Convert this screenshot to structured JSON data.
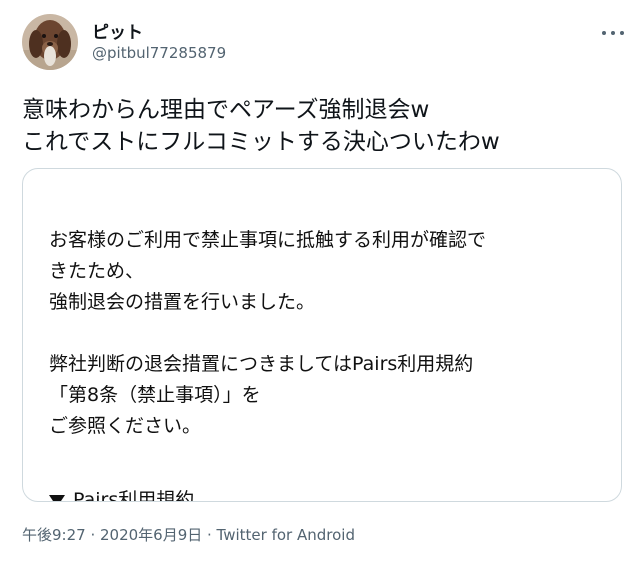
{
  "user": {
    "display_name": "ピット",
    "handle": "@pitbul77285879"
  },
  "tweet": {
    "text": "意味わからん理由でペアーズ強制退会w\nこれでストにフルコミットする決心ついたわw"
  },
  "card": {
    "paragraph1": "お客様のご利用で禁止事項に抵触する利用が確認で\nきたため、\n強制退会の措置を行いました。",
    "paragraph2": "弊社判断の退会措置につきましてはPairs利用規約\n「第8条（禁止事項）」を\nご参照ください。",
    "link_label": "Pairs利用規約"
  },
  "meta": {
    "timestamp": "午後9:27 · 2020年6月9日 · Twitter for Android"
  },
  "icons": {
    "more": "more-horizontal-icon",
    "expand": "triangle-down-icon"
  },
  "colors": {
    "text_primary": "#0f1419",
    "text_secondary": "#536471",
    "card_border": "#cfd9de"
  }
}
